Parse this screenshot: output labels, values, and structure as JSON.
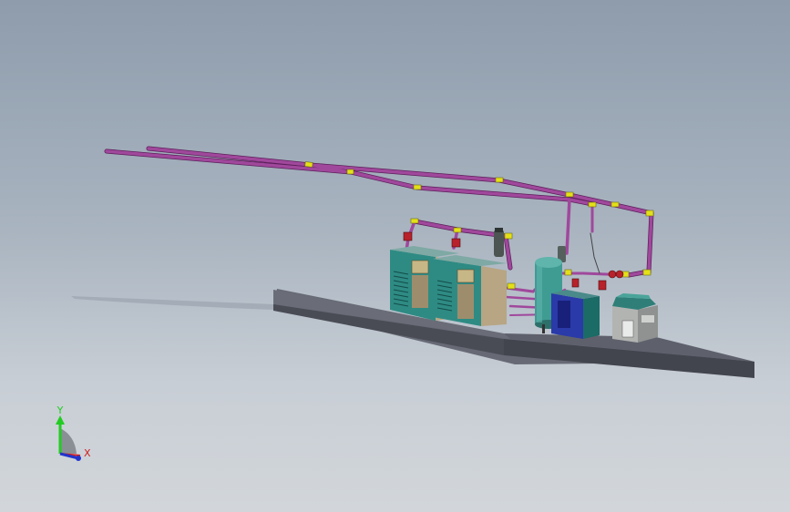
{
  "viewport": {
    "background_top": "#8e9cac",
    "background_bottom": "#d2d6da"
  },
  "colors": {
    "pipe": "#a0489c",
    "pipe_dark": "#5c1f5a",
    "fitting": "#e3e01a",
    "valve": "#b8222a",
    "platform_top": "#6a6d78",
    "platform_side": "#474952",
    "compressor_teal": "#2e8b84",
    "compressor_tan": "#b7a583",
    "tank": "#3f9c93",
    "dryer_blue": "#2a3aa8",
    "cabinet_gray": "#b2b4b2"
  },
  "triad": {
    "y_label": "Y",
    "x_label": "X",
    "y_color": "#22cc22",
    "x_color": "#d02020",
    "z_color": "#2233cc"
  }
}
